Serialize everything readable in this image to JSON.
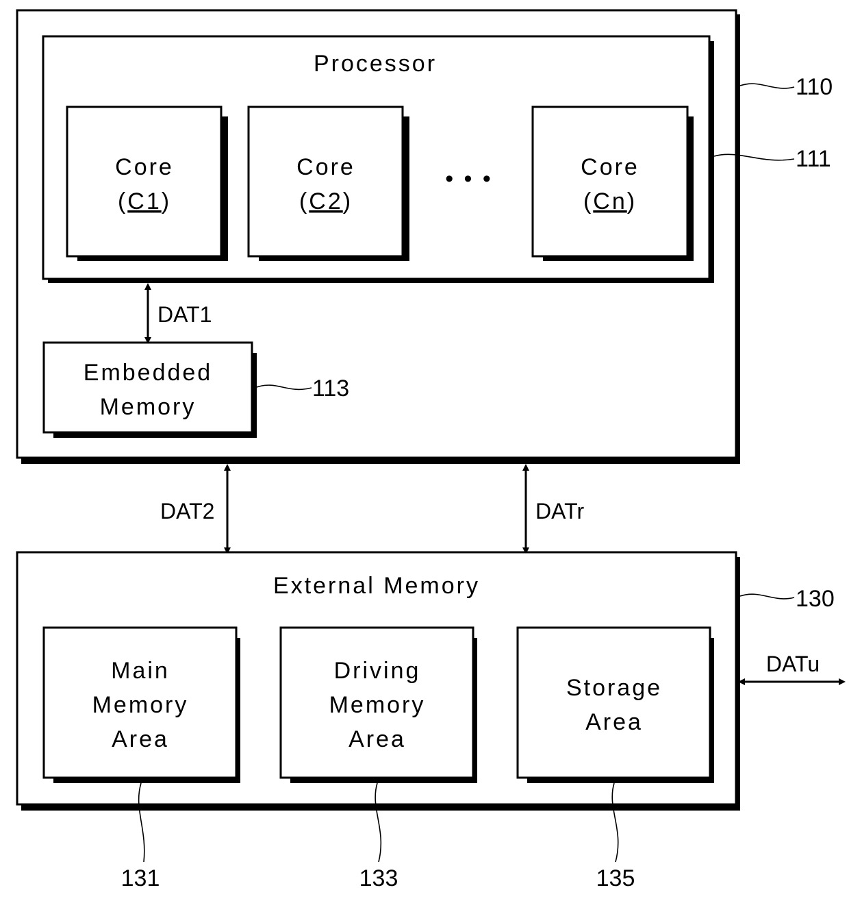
{
  "figure": {
    "system": {
      "ref": "110"
    },
    "processor": {
      "title": "Processor",
      "ref": "111",
      "cores": [
        {
          "line1": "Core",
          "line2": "C1"
        },
        {
          "line1": "Core",
          "line2": "C2"
        },
        {
          "line1": "Core",
          "line2": "Cn"
        }
      ],
      "ellipsis": "• • •"
    },
    "embedded_memory": {
      "line1": "Embedded",
      "line2": "Memory",
      "ref": "113"
    },
    "external_memory": {
      "title": "External Memory",
      "ref": "130",
      "areas": [
        {
          "lines": [
            "Main",
            "Memory",
            "Area"
          ],
          "ref": "131"
        },
        {
          "lines": [
            "Driving",
            "Memory",
            "Area"
          ],
          "ref": "133"
        },
        {
          "lines": [
            "Storage",
            "Area"
          ],
          "ref": "135"
        }
      ]
    },
    "signals": {
      "dat1": "DAT1",
      "dat2": "DAT2",
      "datr": "DATr",
      "datu": "DATu"
    }
  }
}
